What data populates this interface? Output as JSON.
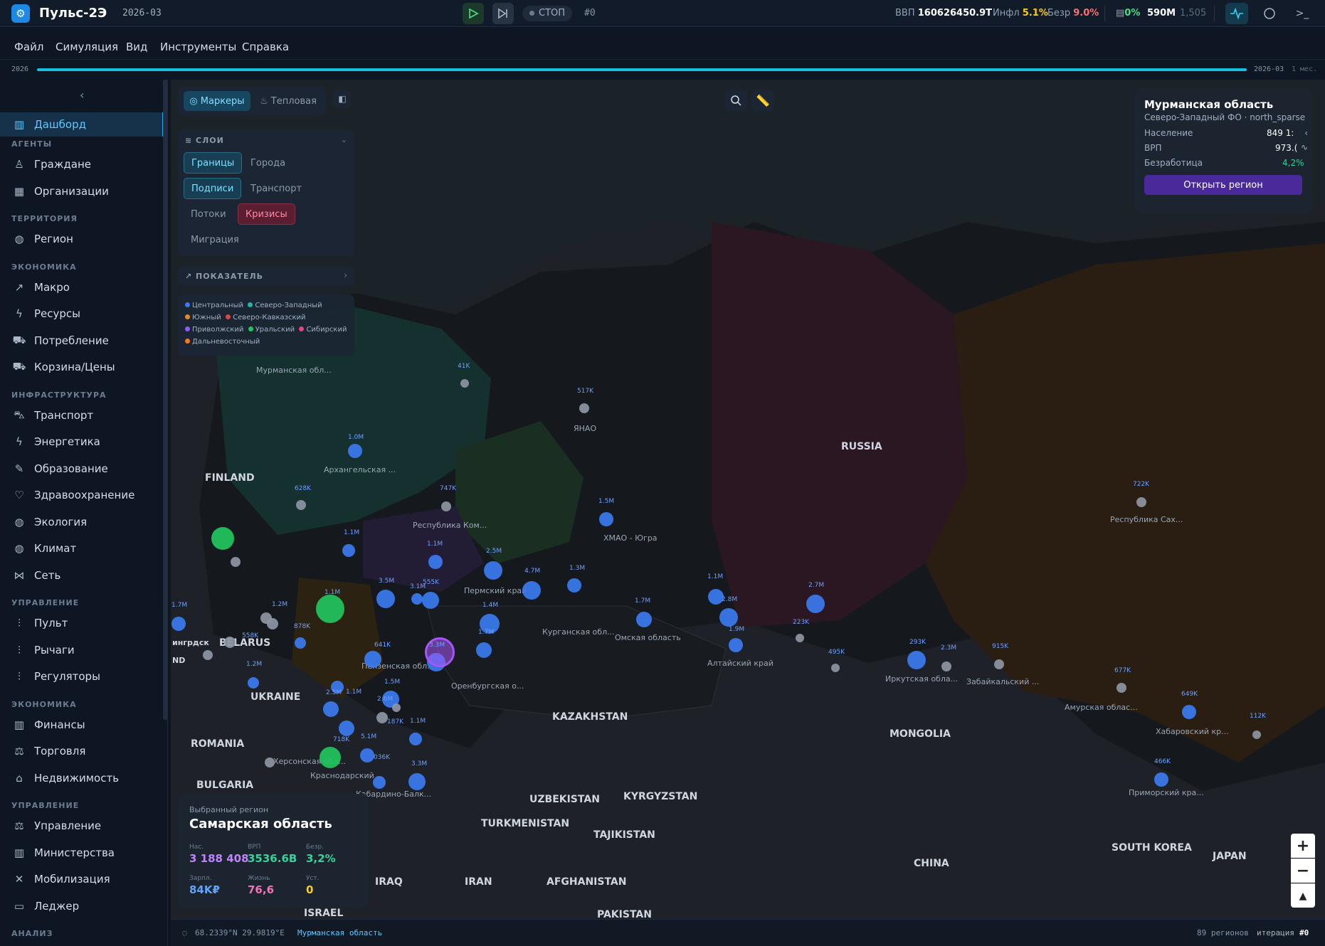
{
  "app": {
    "title": "Пульс-2Э",
    "date": "2026-03",
    "status": "СТОП",
    "iteration": "#0"
  },
  "stats": {
    "gdp_label": "ВВП",
    "gdp_value": "160626450.9T",
    "infl_label": "Инфл",
    "infl_value": "5.1%",
    "unemp_label": "Безр",
    "unemp_value": "9.0%",
    "db_value": "0%",
    "mem_value": "590M",
    "count_value": "1,505"
  },
  "menu": [
    "Файл",
    "Симуляция",
    "Вид",
    "Инструменты",
    "Справка"
  ],
  "timeline": {
    "start": "2026",
    "end": "2026-03",
    "span": "1 мес."
  },
  "sidebar": {
    "dashboard": "Дашборд",
    "sections": [
      {
        "title": "АГЕНТЫ",
        "items": [
          "Граждане",
          "Организации"
        ]
      },
      {
        "title": "ТЕРРИТОРИЯ",
        "items": [
          "Регион"
        ]
      },
      {
        "title": "ЭКОНОМИКА",
        "items": [
          "Макро",
          "Ресурсы",
          "Потребление",
          "Корзина/Цены"
        ]
      },
      {
        "title": "ИНФРАСТРУКТУРА",
        "items": [
          "Транспорт",
          "Энергетика",
          "Образование",
          "Здравоохранение",
          "Экология",
          "Климат",
          "Сеть"
        ]
      },
      {
        "title": "УПРАВЛЕНИЕ",
        "items": [
          "Пульт",
          "Рычаги",
          "Регуляторы"
        ]
      },
      {
        "title": "ЭКОНОМИКА",
        "items": [
          "Финансы",
          "Торговля",
          "Недвижимость"
        ]
      },
      {
        "title": "УПРАВЛЕНИЕ",
        "items": [
          "Управление",
          "Министерства",
          "Мобилизация",
          "Леджер"
        ]
      },
      {
        "title": "АНАЛИЗ",
        "items": []
      }
    ]
  },
  "map_controls": {
    "markers": "Маркеры",
    "heatmap": "Тепловая"
  },
  "layers": {
    "title": "СЛОИ",
    "chips": [
      "Границы",
      "Города",
      "Подписи",
      "Транспорт",
      "Потоки",
      "Кризисы",
      "Миграция"
    ]
  },
  "indicator": {
    "title": "ПОКАЗАТЕЛЬ"
  },
  "legend": [
    {
      "name": "Центральный",
      "color": "#3b7bf0"
    },
    {
      "name": "Северо-Западный",
      "color": "#21b5a5"
    },
    {
      "name": "Южный",
      "color": "#e08a2a"
    },
    {
      "name": "Северо-Кавказский",
      "color": "#e0443c"
    },
    {
      "name": "Приволжский",
      "color": "#8b5cf6"
    },
    {
      "name": "Уральский",
      "color": "#22c55e"
    },
    {
      "name": "Сибирский",
      "color": "#e0457b"
    },
    {
      "name": "Дальневосточный",
      "color": "#f07a2a"
    }
  ],
  "countries": [
    "RUSSIA",
    "FINLAND",
    "BELARUS",
    "UKRAINE",
    "ROMANIA",
    "BULGARIA",
    "KAZAKHSTAN",
    "MONGOLIA",
    "UZBEKISTAN",
    "KYRGYZSTAN",
    "TURKMENISTAN",
    "TAJIKISTAN",
    "AFGHANISTAN",
    "IRAN",
    "IRAQ",
    "ISRAEL",
    "CHINA",
    "SOUTH KOREA",
    "JAPAN",
    "PAKISTAN",
    "ND",
    "ингрдск"
  ],
  "regions": [
    "Мурманская обл...",
    "Архангельская ...",
    "Республика Ком...",
    "ЯНАО",
    "ХМАО - Югра",
    "Пермский край",
    "Курганская обл...",
    "Омская область",
    "Алтайский край",
    "Иркутская обла...",
    "Забайкальский ...",
    "Республика Сах...",
    "Амурская облас...",
    "Хабаровский кр...",
    "Приморский кра...",
    "Пензенская обл...",
    "Оренбургская о...",
    "Херсонская обл...",
    "Краснодарский ...",
    "Кабардино-Балк..."
  ],
  "marker_labels": [
    "1.0M",
    "41K",
    "517K",
    "747K",
    "628K",
    "1.1M",
    "1.5M",
    "1.1M",
    "2.5M",
    "4.7M",
    "1.3M",
    "1.1M",
    "2.7M",
    "1.7M",
    "2.8M",
    "1.9M",
    "223K",
    "495K",
    "293K",
    "2.3M",
    "915K",
    "722K",
    "677K",
    "649K",
    "112K",
    "466K",
    "1.7M",
    "1.2M",
    "878K",
    "1.1M",
    "3.5M",
    "3.1M",
    "555K",
    "1.4M",
    "3.3M",
    "1.7M",
    "641K",
    "1.5M",
    "2.5M",
    "1.1M",
    "718K",
    "5.1M",
    "2.6M",
    "1.1M",
    "3.3M",
    "187K",
    "036K",
    "1.2M",
    "558K"
  ],
  "info_card": {
    "title": "Мурманская область",
    "subtitle": "Северо-Западный ФО · north_sparse",
    "rows": [
      {
        "label": "Население",
        "value": "849 1:"
      },
      {
        "label": "ВРП",
        "value": "973.("
      },
      {
        "label": "Безработица",
        "value": "4,2%"
      }
    ],
    "button": "Открыть регион"
  },
  "selected": {
    "caption": "Выбранный регион",
    "name": "Самарская область",
    "cells": [
      {
        "label": "Нас.",
        "value": "3 188 408",
        "color": "#c084fc"
      },
      {
        "label": "ВРП",
        "value": "3536.6B",
        "color": "#34d399"
      },
      {
        "label": "Безр.",
        "value": "3,2%",
        "color": "#34d399"
      },
      {
        "label": "Зарпл.",
        "value": "84K₽",
        "color": "#60a5fa"
      },
      {
        "label": "Жизнь",
        "value": "76,6",
        "color": "#f472b6"
      },
      {
        "label": "Уст.",
        "value": "0",
        "color": "#facc15"
      }
    ]
  },
  "status": {
    "coords": "68.2339°N 29.9819°E",
    "region": "Мурманская область",
    "regions_count": "89 регионов",
    "iteration_label": "итерация",
    "iteration_value": "#0"
  }
}
